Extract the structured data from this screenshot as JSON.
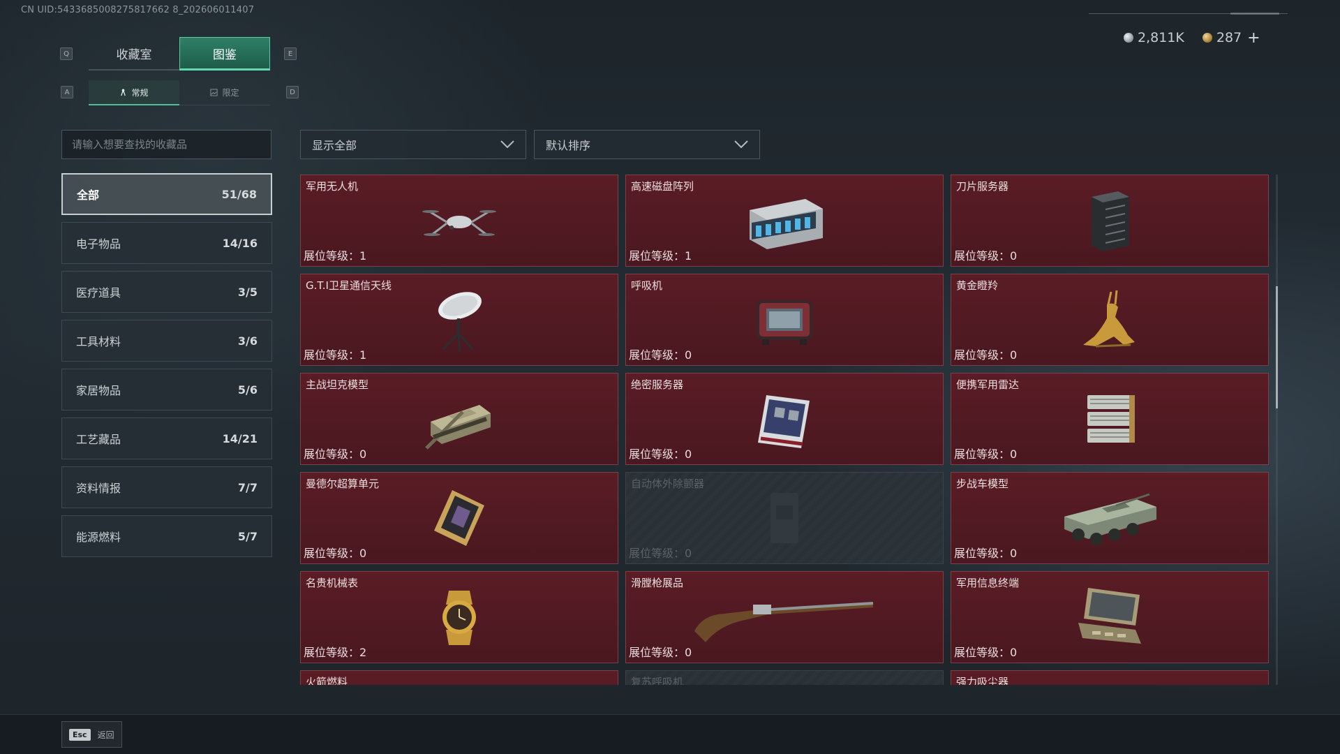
{
  "header": {
    "uid": "CN UID:5433685008275817662 8_202606011407",
    "currency": [
      {
        "icon": "silver-coin-icon",
        "value": "2,811K"
      },
      {
        "icon": "gold-coin-icon",
        "value": "287"
      }
    ],
    "add_label": "+"
  },
  "keys": {
    "prev_tab": "Q",
    "next_tab": "E",
    "prev_sub": "A",
    "next_sub": "D"
  },
  "tabs": [
    {
      "label": "收藏室",
      "active": false
    },
    {
      "label": "图鉴",
      "active": true
    }
  ],
  "subtabs": [
    {
      "label": "常规",
      "icon": "figure-icon",
      "active": true
    },
    {
      "label": "限定",
      "icon": "image-icon",
      "active": false
    }
  ],
  "search": {
    "placeholder": "请输入想要查找的收藏品"
  },
  "filters": {
    "display": {
      "value": "显示全部"
    },
    "sort": {
      "value": "默认排序"
    }
  },
  "categories": [
    {
      "label": "全部",
      "count": "51/68",
      "active": true
    },
    {
      "label": "电子物品",
      "count": "14/16",
      "active": false
    },
    {
      "label": "医疗道具",
      "count": "3/5",
      "active": false
    },
    {
      "label": "工具材料",
      "count": "3/6",
      "active": false
    },
    {
      "label": "家居物品",
      "count": "5/6",
      "active": false
    },
    {
      "label": "工艺藏品",
      "count": "14/21",
      "active": false
    },
    {
      "label": "资料情报",
      "count": "7/7",
      "active": false
    },
    {
      "label": "能源燃料",
      "count": "5/7",
      "active": false
    }
  ],
  "level_label": "展位等级：",
  "items": [
    {
      "name": "军用无人机",
      "level": "1",
      "icon": "drone-icon",
      "locked": false
    },
    {
      "name": "高速磁盘阵列",
      "level": "1",
      "icon": "disk-array-icon",
      "locked": false
    },
    {
      "name": "刀片服务器",
      "level": "0",
      "icon": "blade-server-icon",
      "locked": false
    },
    {
      "name": "G.T.I卫星通信天线",
      "level": "1",
      "icon": "satellite-dish-icon",
      "locked": false
    },
    {
      "name": "呼吸机",
      "level": "0",
      "icon": "ventilator-icon",
      "locked": false
    },
    {
      "name": "黄金瞪羚",
      "level": "0",
      "icon": "golden-gazelle-icon",
      "locked": false
    },
    {
      "name": "主战坦克模型",
      "level": "0",
      "icon": "tank-model-icon",
      "locked": false
    },
    {
      "name": "绝密服务器",
      "level": "0",
      "icon": "secret-server-icon",
      "locked": false
    },
    {
      "name": "便携军用雷达",
      "level": "0",
      "icon": "radar-icon",
      "locked": false
    },
    {
      "name": "曼德尔超算单元",
      "level": "0",
      "icon": "supercomputer-unit-icon",
      "locked": false
    },
    {
      "name": "自动体外除颤器",
      "level": "0",
      "icon": "defibrillator-icon",
      "locked": true
    },
    {
      "name": "步战车模型",
      "level": "0",
      "icon": "ifv-model-icon",
      "locked": false
    },
    {
      "name": "名贵机械表",
      "level": "2",
      "icon": "watch-icon",
      "locked": false
    },
    {
      "name": "滑膛枪展品",
      "level": "0",
      "icon": "musket-icon",
      "locked": false
    },
    {
      "name": "军用信息终端",
      "level": "0",
      "icon": "terminal-icon",
      "locked": false
    },
    {
      "name": "火箭燃料",
      "level": "",
      "icon": "rocket-fuel-icon",
      "locked": false
    },
    {
      "name": "复苏呼吸机",
      "level": "",
      "icon": "resuscitator-icon",
      "locked": true
    },
    {
      "name": "强力吸尘器",
      "level": "",
      "icon": "vacuum-icon",
      "locked": false
    }
  ],
  "footer": {
    "key": "Esc",
    "label": "返回"
  }
}
